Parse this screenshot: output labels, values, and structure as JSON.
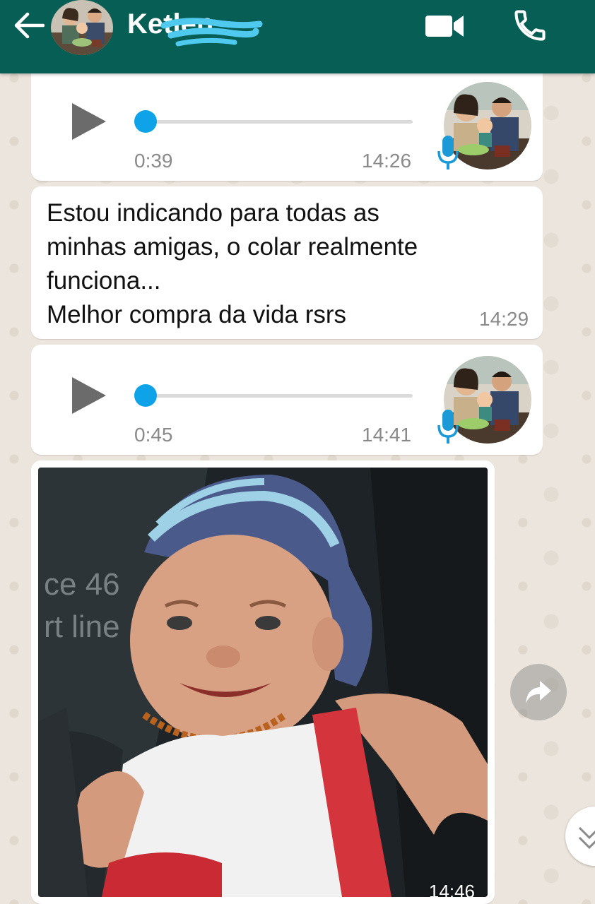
{
  "header": {
    "contact_name": "Ketlen",
    "colors": {
      "bar": "#075e54",
      "redaction": "#4fc9ee"
    }
  },
  "messages": [
    {
      "type": "voice",
      "duration": "0:39",
      "time": "14:26",
      "progress": 0
    },
    {
      "type": "text",
      "text": "Estou indicando para todas as\nminhas amigas, o colar realmente\nfunciona...\nMelhor compra da vida rsrs",
      "time": "14:29"
    },
    {
      "type": "voice",
      "duration": "0:45",
      "time": "14:41",
      "progress": 0
    },
    {
      "type": "image",
      "photo_text": "ce 46\nrt line",
      "time": "14:46"
    }
  ],
  "colors": {
    "accent": "#0ea3e8",
    "bubble": "#ffffff",
    "wallpaper": "#ece5dd"
  }
}
